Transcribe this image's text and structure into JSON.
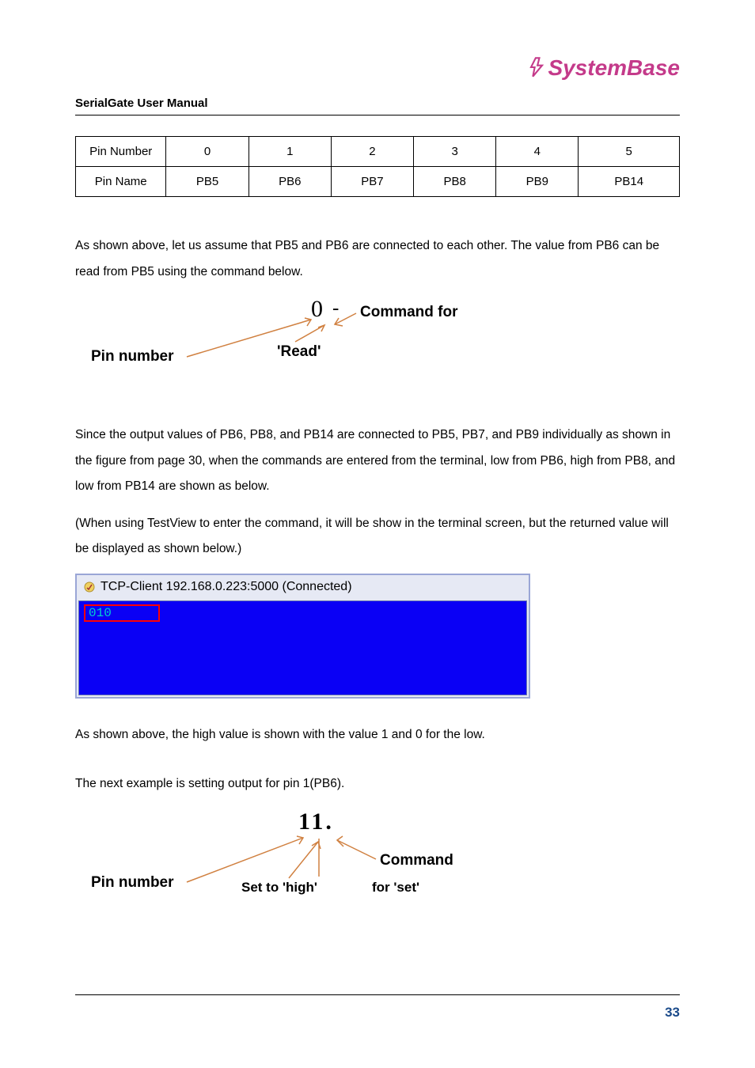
{
  "logo": "SystemBase",
  "header": "SerialGate User Manual",
  "table": {
    "row1": [
      "Pin Number",
      "0",
      "1",
      "2",
      "3",
      "4",
      "5"
    ],
    "row2": [
      "Pin Name",
      "PB5",
      "PB6",
      "PB7",
      "PB8",
      "PB9",
      "PB14"
    ]
  },
  "p1": "As shown above, let us assume that PB5 and PB6 are connected to each other. The value from PB6 can be read from PB5 using the command below.",
  "diagram1": {
    "cmd": "0",
    "dash": "-",
    "pin_label": "Pin number",
    "command_for": "Command for",
    "read": "'Read'"
  },
  "p2": "Since the output values of PB6, PB8, and PB14 are connected to PB5, PB7, and PB9 individually as shown in the figure from page 30, when the commands are entered from the terminal, low from PB6, high from PB8, and low from PB14 are shown as below.",
  "p3": "(When using TestView to enter the command, it will be show in the terminal screen, but the returned value will be displayed as shown below.)",
  "terminal": {
    "title": "TCP-Client 192.168.0.223:5000 (Connected)",
    "value": "010"
  },
  "p4": "As shown above, the high value is shown with the value 1 and 0 for the low.",
  "p5": "The next example is setting output for pin 1(PB6).",
  "diagram2": {
    "cmd": "11.",
    "pin_label": "Pin number",
    "set_label": "Set to 'high'",
    "command_label": "Command",
    "for_label": "for 'set'"
  },
  "page_number": "33"
}
